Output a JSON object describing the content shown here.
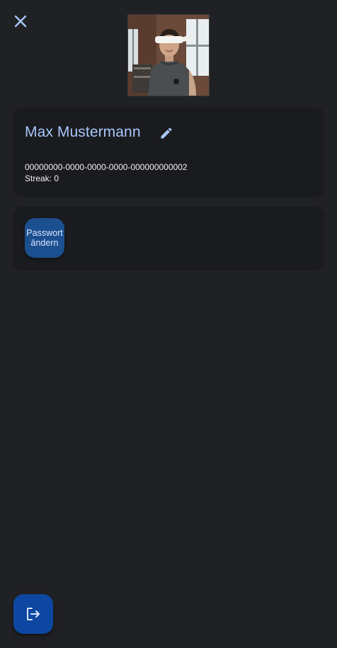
{
  "header": {
    "close_icon": "close-icon"
  },
  "profile": {
    "avatar_icon": "user-photo",
    "name": "Max Mustermann",
    "edit_icon": "pencil-icon",
    "id": "00000000-0000-0000-0000-000000000002",
    "streak": "Streak: 0"
  },
  "actions": {
    "change_password_line1": "Passwort",
    "change_password_line2": "ändern"
  },
  "footer": {
    "logout_icon": "logout-icon"
  },
  "colors": {
    "background": "#202124",
    "card": "#1a1b1e",
    "accent": "#a8c7fa",
    "button": "#1c4f8f",
    "fab": "#0d47a1"
  }
}
